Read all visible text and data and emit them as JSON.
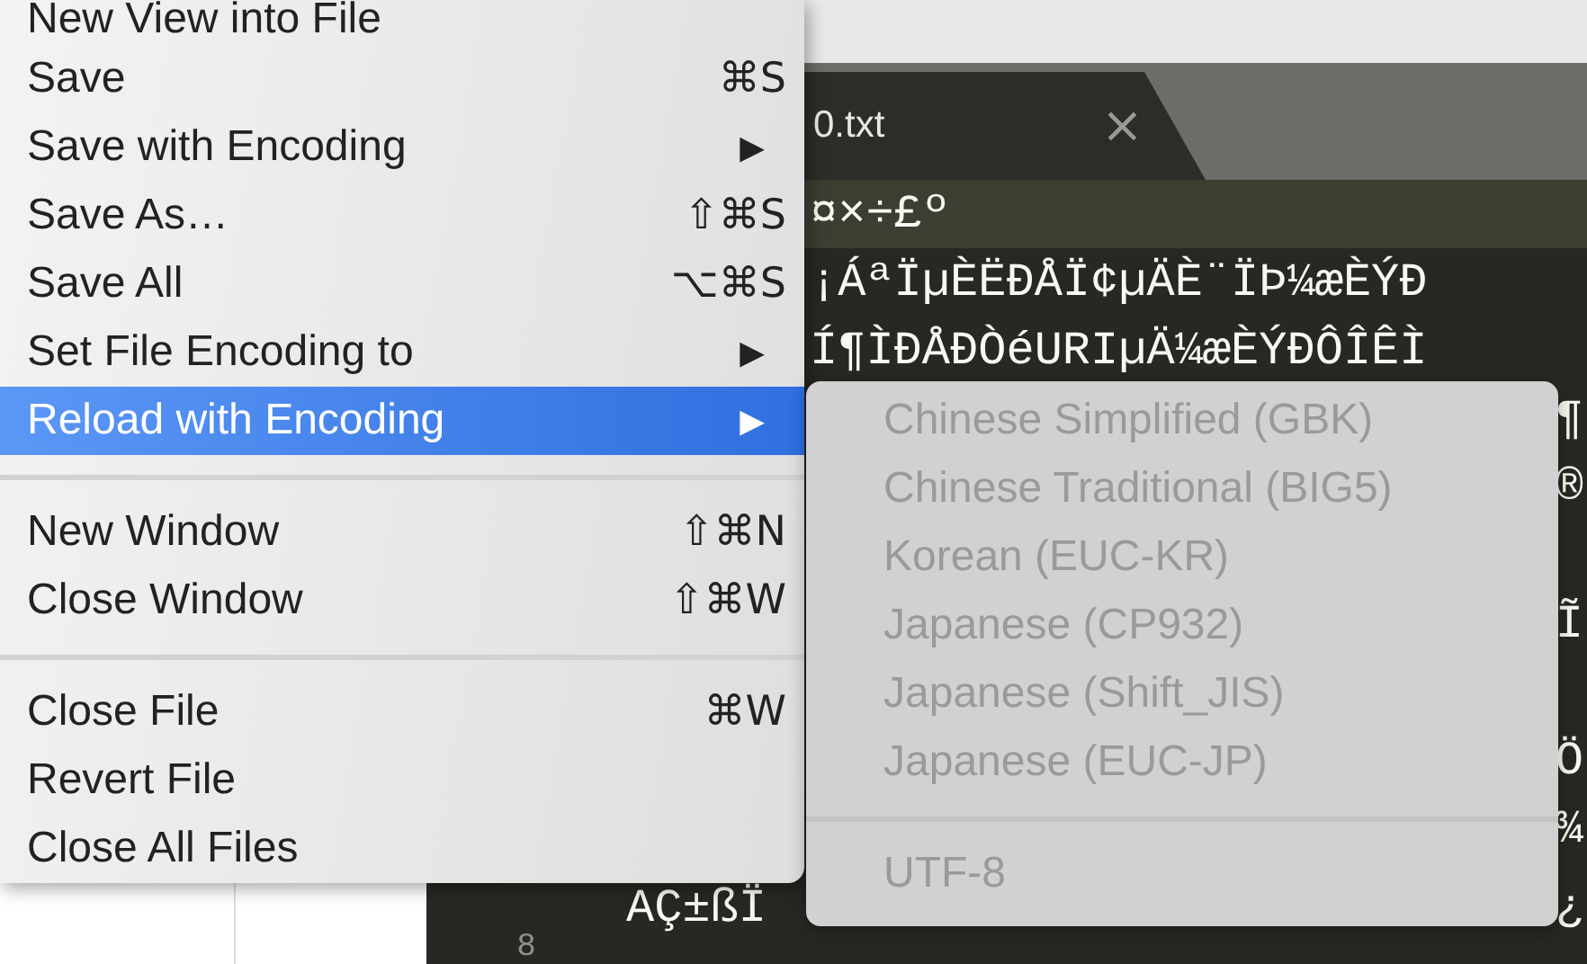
{
  "tab": {
    "title": "0.txt",
    "close": "×"
  },
  "editor": {
    "lines": [
      {
        "current": true,
        "kind": "partial",
        "text": "¤×÷£º"
      },
      {
        "current": false,
        "kind": "partial",
        "text": "¡ÁªÏµÈËÐÅÏ¢µÄÈ¨ÏÞ¼æÈÝÐ"
      },
      {
        "current": false,
        "kind": "partial",
        "text": "Í¶ÌÐÅÐÒéURIµÄ¼æÈÝÐÔÎÊÌ"
      },
      {
        "current": false,
        "edge": "¶"
      },
      {
        "current": false,
        "edge": "®"
      },
      {
        "current": false
      },
      {
        "current": false,
        "edge": "Ĩ"
      },
      {
        "current": false
      },
      {
        "current": false,
        "edge": "Ö"
      },
      {
        "current": false,
        "edge": "¾"
      },
      {
        "current": false,
        "kind": "full",
        "text": "AÇ±ßÏ",
        "edge": "¿"
      }
    ],
    "next_line_number": "8"
  },
  "menu": {
    "items": [
      {
        "kind": "item",
        "label": "New View into File",
        "selected": false
      },
      {
        "kind": "item",
        "label": "Save",
        "shortcut": "⌘S",
        "selected": false
      },
      {
        "kind": "item",
        "label": "Save with Encoding",
        "arrow": "▶",
        "selected": false
      },
      {
        "kind": "item",
        "label": "Save As…",
        "shortcut": "⇧⌘S",
        "selected": false
      },
      {
        "kind": "item",
        "label": "Save All",
        "shortcut": "⌥⌘S",
        "selected": false
      },
      {
        "kind": "item",
        "label": "Set File Encoding to",
        "arrow": "▶",
        "selected": false
      },
      {
        "kind": "item",
        "label": "Reload with Encoding",
        "arrow": "▶",
        "selected": true
      },
      {
        "kind": "separator"
      },
      {
        "kind": "item",
        "label": "New Window",
        "shortcut": "⇧⌘N",
        "selected": false
      },
      {
        "kind": "item",
        "label": "Close Window",
        "shortcut": "⇧⌘W",
        "selected": false
      },
      {
        "kind": "separator"
      },
      {
        "kind": "item",
        "label": "Close File",
        "shortcut": "⌘W",
        "selected": false
      },
      {
        "kind": "item",
        "label": "Revert File",
        "selected": false
      },
      {
        "kind": "item",
        "label": "Close All Files",
        "selected": false
      }
    ]
  },
  "submenu": {
    "items": [
      {
        "kind": "item",
        "label": "Chinese Simplified (GBK)",
        "disabled": true
      },
      {
        "kind": "item",
        "label": "Chinese Traditional (BIG5)",
        "disabled": true
      },
      {
        "kind": "item",
        "label": "Korean (EUC-KR)",
        "disabled": true
      },
      {
        "kind": "item",
        "label": "Japanese (CP932)",
        "disabled": true
      },
      {
        "kind": "item",
        "label": "Japanese (Shift_JIS)",
        "disabled": true
      },
      {
        "kind": "item",
        "label": "Japanese (EUC-JP)",
        "disabled": true
      },
      {
        "kind": "separator"
      },
      {
        "kind": "item",
        "label": "UTF-8",
        "disabled": true
      }
    ]
  }
}
